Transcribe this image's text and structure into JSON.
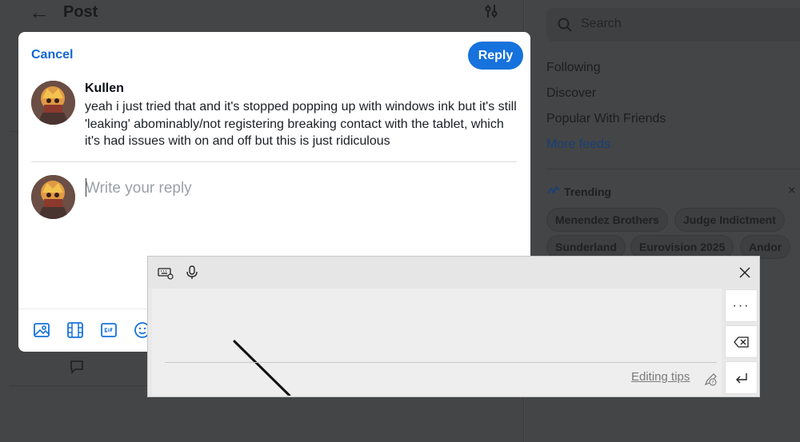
{
  "background": {
    "header": {
      "title": "Post"
    },
    "sidebar": {
      "search_placeholder": "Search",
      "feeds": [
        "Following",
        "Discover",
        "Popular With Friends"
      ],
      "more_feeds": "More feeds",
      "trending_title": "Trending",
      "trending": [
        "Menendez Brothers",
        "Judge Indictment",
        "Sunderland",
        "Eurovision 2025",
        "Andor"
      ]
    }
  },
  "modal": {
    "cancel_label": "Cancel",
    "reply_label": "Reply",
    "post": {
      "author": "Kullen",
      "text": "yeah i just tried that and it's stopped popping up with windows ink but it's still 'leaking' abominably/not registering breaking contact with the tablet, which it's had issues with on and off but this is just ridiculous"
    },
    "reply_placeholder": "Write your reply",
    "toolbar_icons": [
      "image-icon",
      "video-icon",
      "gif-icon",
      "emoji-icon"
    ]
  },
  "handwriting_panel": {
    "editing_tips": "Editing tips",
    "more_label": "···"
  },
  "colors": {
    "accent": "#1672dc",
    "link": "#1266d6"
  }
}
